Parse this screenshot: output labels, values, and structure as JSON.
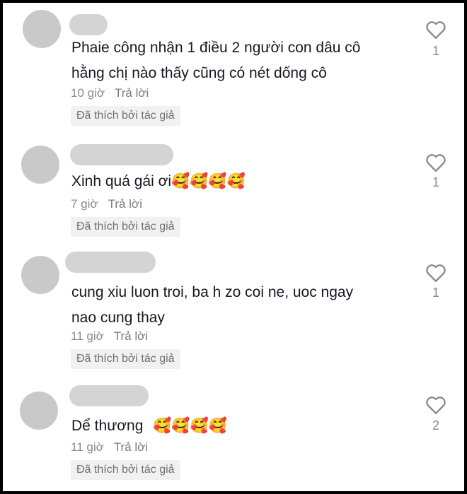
{
  "comments": [
    {
      "text_lines": [
        "Phaie công nhận 1 điều 2 người con dâu cô",
        "hằng chị nào thấy cũng có nét dống cô"
      ],
      "time": "10 giờ",
      "reply_label": "Trả lời",
      "liked_by_author": "Đã thích bởi tác giả",
      "like_count": "1"
    },
    {
      "text_lines": [
        "Xinh quá gái ơi"
      ],
      "emoji": "🥰🥰🥰🥰",
      "time": "7 giờ",
      "reply_label": "Trả lời",
      "liked_by_author": "Đã thích bởi tác giả",
      "like_count": "1"
    },
    {
      "text_lines": [
        "cung xiu luon troi, ba h zo coi ne, uoc ngay",
        "nao cung thay"
      ],
      "time": "11 giờ",
      "reply_label": "Trả lời",
      "liked_by_author": "Đã thích bởi tác giả",
      "like_count": "1"
    },
    {
      "text_lines": [
        "Dể thương"
      ],
      "emoji": "🥰🥰🥰🥰",
      "time": "11 giờ",
      "reply_label": "Trả lời",
      "liked_by_author": "Đã thích bởi tác giả",
      "like_count": "2"
    }
  ],
  "icons": {
    "like": "heart-outline-icon",
    "avatar": "avatar-placeholder"
  },
  "colors": {
    "text": "#161823",
    "meta": "#8a8b91",
    "badge_bg": "#f1f1f2",
    "avatar": "#c9c9c9"
  }
}
